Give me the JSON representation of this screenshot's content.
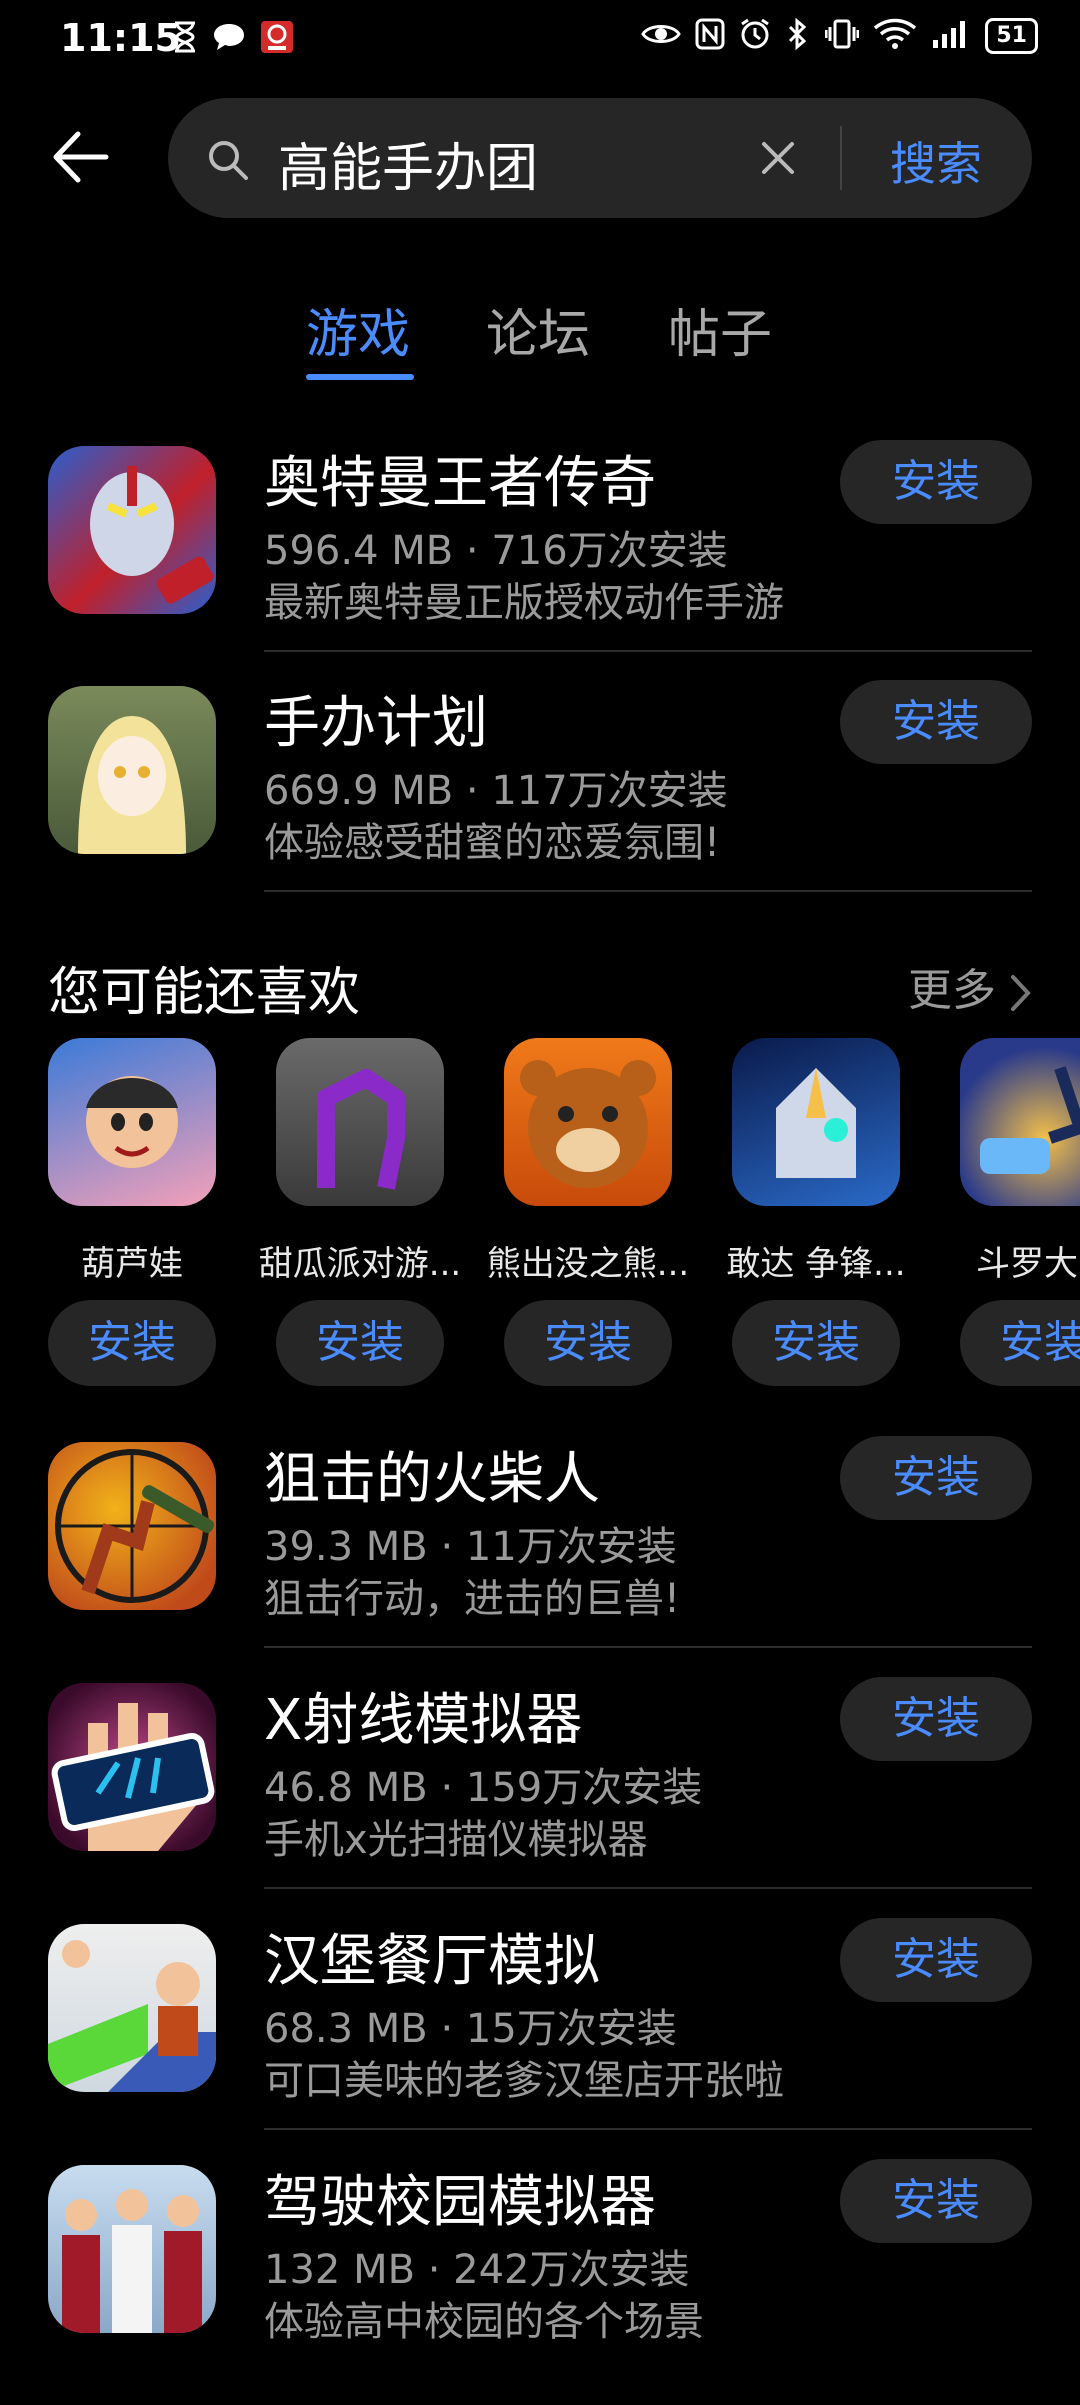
{
  "status_bar": {
    "time": "11:15",
    "battery": "51",
    "icons": [
      "hourglass-icon",
      "chat-icon",
      "app-badge-icon",
      "eye-icon",
      "nfc-icon",
      "alarm-icon",
      "bluetooth-icon",
      "vibrate-icon",
      "wifi-icon",
      "signal-icon",
      "battery-icon"
    ]
  },
  "search": {
    "query": "高能手办团",
    "button": "搜索"
  },
  "tabs": [
    {
      "label": "游戏"
    },
    {
      "label": "论坛"
    },
    {
      "label": "帖子"
    }
  ],
  "results": [
    {
      "title": "奥特曼王者传奇",
      "meta": "596.4 MB · 716万次安装",
      "desc": "最新奥特曼正版授权动作手游",
      "install": "安装",
      "colors": [
        "#c0202a",
        "#2a5fcf"
      ]
    },
    {
      "title": "手办计划",
      "meta": "669.9 MB · 117万次安装",
      "desc": "体验感受甜蜜的恋爱氛围!",
      "install": "安装",
      "colors": [
        "#7a8a5a",
        "#f3e39a"
      ]
    }
  ],
  "recommend": {
    "title": "您可能还喜欢",
    "more": "更多",
    "items": [
      {
        "name": "葫芦娃",
        "install": "安装",
        "colors": [
          "#f4a0b8",
          "#3a7ad8"
        ]
      },
      {
        "name": "甜瓜派对游...",
        "install": "安装",
        "colors": [
          "#5a5a5a",
          "#8a2ac8"
        ]
      },
      {
        "name": "熊出没之熊...",
        "install": "安装",
        "colors": [
          "#f07a1a",
          "#b8601a"
        ]
      },
      {
        "name": "敢达 争锋...",
        "install": "安装",
        "colors": [
          "#1a3a7a",
          "#cfd8e8"
        ]
      },
      {
        "name": "斗罗大陆",
        "install": "安装",
        "colors": [
          "#2a3a8a",
          "#f4c04a"
        ]
      }
    ]
  },
  "results2": [
    {
      "title": "狙击的火柴人",
      "meta": "39.3 MB · 11万次安装",
      "desc": "狙击行动，进击的巨兽!",
      "install": "安装",
      "colors": [
        "#f2b21a",
        "#c04a1a"
      ]
    },
    {
      "title": "X射线模拟器",
      "meta": "46.8 MB · 159万次安装",
      "desc": "手机x光扫描仪模拟器",
      "install": "安装",
      "colors": [
        "#7a1a5a",
        "#2ac0f0"
      ]
    },
    {
      "title": "汉堡餐厅模拟",
      "meta": "68.3 MB · 15万次安装",
      "desc": "可口美味的老爹汉堡店开张啦",
      "install": "安装",
      "colors": [
        "#5ad83a",
        "#3a5ab8"
      ]
    },
    {
      "title": "驾驶校园模拟器",
      "meta": "132 MB · 242万次安装",
      "desc": "体验高中校园的各个场景",
      "install": "安装",
      "colors": [
        "#c8dcef",
        "#a01a2a"
      ]
    }
  ]
}
